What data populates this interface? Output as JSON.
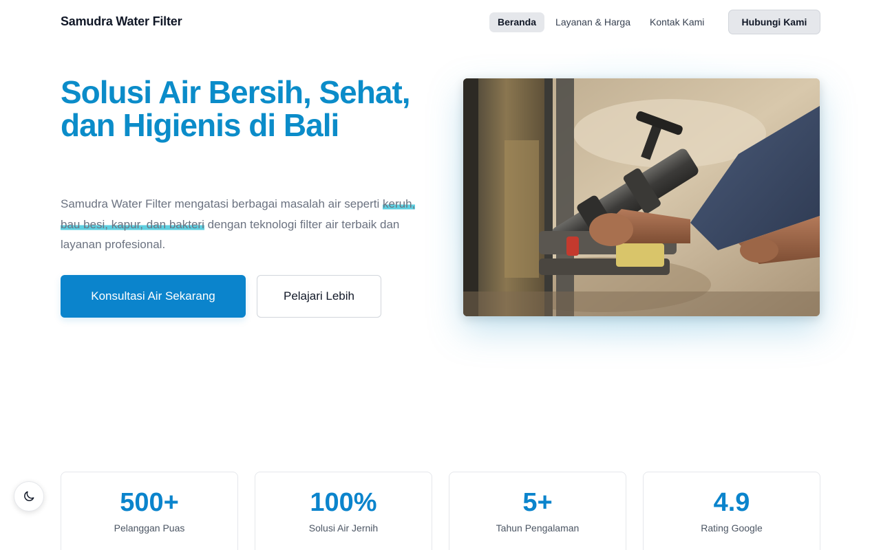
{
  "header": {
    "brand": "Samudra Water Filter",
    "nav": [
      {
        "label": "Beranda",
        "active": true
      },
      {
        "label": "Layanan & Harga",
        "active": false
      },
      {
        "label": "Kontak Kami",
        "active": false
      }
    ],
    "cta_label": "Hubungi Kami"
  },
  "hero": {
    "title": "Solusi Air Bersih, Sehat, dan Higienis di Bali",
    "description_before": "Samudra Water Filter mengatasi berbagai masalah air seperti ",
    "description_highlight": "keruh, bau besi, kapur, dan bakteri",
    "description_after": " dengan teknologi filter air terbaik dan layanan profesional.",
    "primary_button": "Konsultasi Air Sekarang",
    "secondary_button": "Pelajari Lebih"
  },
  "stats": [
    {
      "value": "500+",
      "label": "Pelanggan Puas"
    },
    {
      "value": "100%",
      "label": "Solusi Air Jernih"
    },
    {
      "value": "5+",
      "label": "Tahun Pengalaman"
    },
    {
      "value": "4.9",
      "label": "Rating Google"
    }
  ],
  "theme_toggle": {
    "icon": "moon-icon"
  },
  "colors": {
    "accent": "#0b84cc",
    "title": "#0b8cc9",
    "highlight": "#5ecfe0"
  }
}
